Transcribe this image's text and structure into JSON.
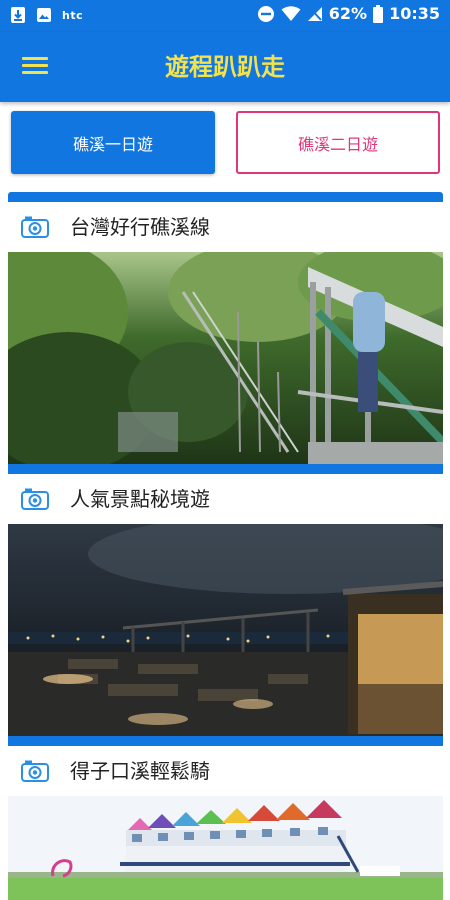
{
  "status_bar": {
    "carrier": "htc",
    "battery": "62%",
    "time": "10:35"
  },
  "app_bar": {
    "title": "遊程趴趴走"
  },
  "tabs": [
    {
      "label": "礁溪一日遊",
      "selected": true
    },
    {
      "label": "礁溪二日遊",
      "selected": false
    }
  ],
  "tours": [
    {
      "title": "台灣好行礁溪線",
      "icon": "camera-icon"
    },
    {
      "title": "人氣景點秘境遊",
      "icon": "camera-icon"
    },
    {
      "title": "得子口溪輕鬆騎",
      "icon": "camera-icon"
    }
  ],
  "colors": {
    "primary": "#1276e0",
    "title_yellow": "#f3e24c",
    "accent_pink": "#e0357a"
  }
}
